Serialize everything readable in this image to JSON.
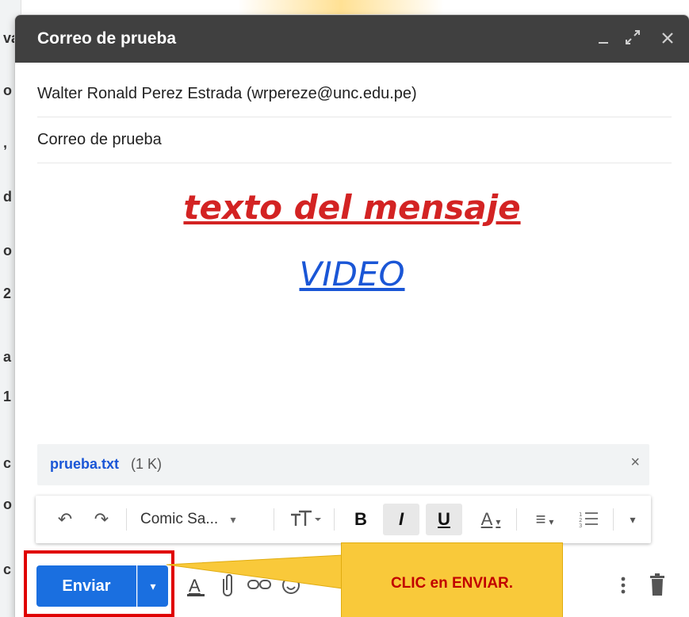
{
  "compose": {
    "title": "Correo de prueba",
    "to": "Walter Ronald Perez Estrada (wrpereze@unc.edu.pe)",
    "subject": "Correo de prueba",
    "body_line1": "texto del mensaje",
    "body_line2": "VIDEO",
    "window_icons": [
      "minimize-icon",
      "expand-icon",
      "close-icon"
    ]
  },
  "attachment": {
    "name": "prueba.txt",
    "size": "(1 K)",
    "close": "×"
  },
  "toolbar": {
    "undo": "↶",
    "redo": "↷",
    "font": "Comic Sa...",
    "font_caret": "▾",
    "size_icon": "T",
    "bold": "B",
    "italic": "I",
    "underline": "U",
    "text_color": "A",
    "align": "≡",
    "numbered_list": "☰",
    "more": "▾"
  },
  "actions": {
    "send": "Enviar",
    "send_dropdown": "▾"
  },
  "callout": {
    "text": "CLIC en ENVIAR."
  },
  "background": {
    "fragments": [
      "va",
      "o",
      ",",
      "d",
      "o",
      "2",
      "a",
      "1",
      "c",
      "o",
      "c"
    ]
  },
  "colors": {
    "header": "#404040",
    "send_blue": "#1a6fe0",
    "body_red": "#d32323",
    "body_blue": "#1a56d6",
    "callout_yellow": "#f9c93a",
    "highlight_red": "#e00000"
  }
}
